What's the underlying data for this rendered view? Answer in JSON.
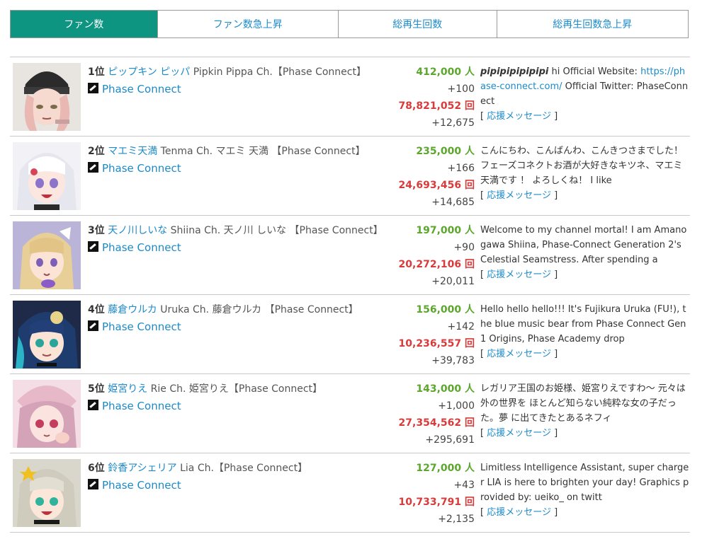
{
  "tabs": [
    {
      "label": "ファン数",
      "active": true
    },
    {
      "label": "ファン数急上昇",
      "active": false
    },
    {
      "label": "総再生回数",
      "active": false
    },
    {
      "label": "総再生回数急上昇",
      "active": false
    }
  ],
  "support_label": "応援メッセージ",
  "colors": {
    "accent": "#0e9582",
    "link": "#1c8ac8",
    "fans": "#5aa72c",
    "plays": "#d93a3a"
  },
  "rows": [
    {
      "rank": "1位",
      "name": "ピップキン ピッパ",
      "channel": "Pipkin Pippa Ch.【Phase Connect】",
      "agency": "Phase Connect",
      "fans": "412,000 人",
      "fans_delta": "+100",
      "plays": "78,821,052 回",
      "plays_delta": "+12,675",
      "desc_bold": "pipipipipipipi",
      "desc_pre": " hi Official Website: ",
      "desc_link": "https://phase-connect.com/",
      "desc_post": " Official Twitter: PhaseConnect"
    },
    {
      "rank": "2位",
      "name": "マエミ天満",
      "channel": "Tenma Ch. マエミ 天満 【Phase Connect】",
      "agency": "Phase Connect",
      "fans": "235,000 人",
      "fans_delta": "+166",
      "plays": "24,693,456 回",
      "plays_delta": "+14,685",
      "desc": "こんにちわ、こんばんわ、こんきつさまでした！フェーズコネクトお酒が大好きなキツネ、マエミ天満です ！ よろしくね！ I like"
    },
    {
      "rank": "3位",
      "name": "天ノ川しいな",
      "channel": "Shiina Ch. 天ノ川 しいな 【Phase Connect】",
      "agency": "Phase Connect",
      "fans": "197,000 人",
      "fans_delta": "+90",
      "plays": "20,272,106 回",
      "plays_delta": "+20,011",
      "desc": "Welcome to my channel mortal! I am Amanogawa Shiina, Phase-Connect Generation 2's Celestial Seamstress. After spending a"
    },
    {
      "rank": "4位",
      "name": "藤倉ウルカ",
      "channel": "Uruka Ch. 藤倉ウルカ 【Phase Connect】",
      "agency": "Phase Connect",
      "fans": "156,000 人",
      "fans_delta": "+142",
      "plays": "10,236,557 回",
      "plays_delta": "+39,783",
      "desc": "Hello hello hello!!! It's Fujikura Uruka (FU!), the blue music bear from Phase Connect Gen 1 Origins, Phase Academy drop"
    },
    {
      "rank": "5位",
      "name": "姫宮りえ",
      "channel": "Rie Ch. 姫宮りえ【Phase Connect】",
      "agency": "Phase Connect",
      "fans": "143,000 人",
      "fans_delta": "+1,000",
      "plays": "27,354,562 回",
      "plays_delta": "+295,691",
      "desc": "レガリア王国のお姫様、姫宮りえですわ〜 元々は外の世界を ほとんど知らない純粋な女の子だった。夢 に出てきたとあるネフィ"
    },
    {
      "rank": "6位",
      "name": "鈴香アシェリア",
      "channel": "Lia Ch.【Phase Connect】",
      "agency": "Phase Connect",
      "fans": "127,000 人",
      "fans_delta": "+43",
      "plays": "10,733,791 回",
      "plays_delta": "+2,135",
      "desc": "Limitless Intelligence Assistant, super charger LIA is here to brighten your day! Graphics provided by: ueiko_ on twitt"
    }
  ]
}
